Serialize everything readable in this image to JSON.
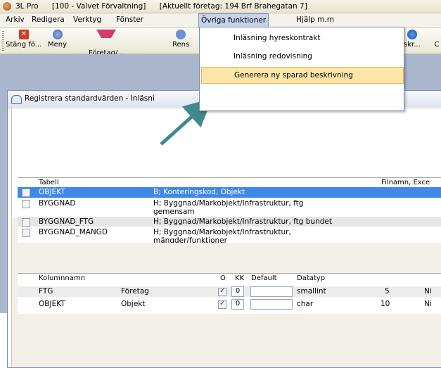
{
  "titlebar": {
    "app": "3L Pro",
    "db": "[100 - Valvet Förvaltning]",
    "company": "[Aktuellt företag: 194 Brf Brahegatan 7]"
  },
  "menubar": [
    "Arkiv",
    "Redigera",
    "Verktyg",
    "Fönster",
    "Övriga funktioner",
    "Hjälp m.m"
  ],
  "toolbar": [
    "Stäng fö...",
    "Meny",
    "Företag/...",
    "Rens",
    "skr...",
    "C"
  ],
  "dropdown": [
    "Inläsning hyreskontrakt",
    "Inläsning redovisning",
    "Generera ny sparad beskrivning"
  ],
  "window": {
    "title": "Registrera standardvärden - Inläsni"
  },
  "tables": {
    "headers": [
      "Tabell",
      "Filnamn, Exce"
    ],
    "rows": [
      {
        "name": "OBJEKT",
        "desc": "B; Konteringskod, Objekt"
      },
      {
        "name": "BYGGNAD",
        "desc": "H; Byggnad/Markobjekt/Infrastruktur, ftg",
        "desc2": "gemensam"
      },
      {
        "name": "BYGGNAD_FTG",
        "desc": "H; Byggnad/Markobjekt/Infrastruktur, ftg bundet"
      },
      {
        "name": "BYGGNAD_MANGD",
        "desc": "H; Byggnad/Markobjekt/Infrastruktur,",
        "desc2": "mängder/funktioner"
      }
    ]
  },
  "columns": {
    "headers": [
      "Kolumnnamn",
      "O",
      "KK",
      "Default",
      "Datatyp"
    ],
    "rows": [
      {
        "name": "FTG",
        "label": "Företag",
        "kk": "0",
        "type": "smallint",
        "len": "5",
        "tail": "Ni"
      },
      {
        "name": "OBJEKT",
        "label": "Objekt",
        "kk": "0",
        "type": "char",
        "len": "10",
        "tail": "Ni"
      }
    ]
  },
  "colors": {
    "selection": "#3e88e8",
    "highlight": "#fbe6a7",
    "arrow": "#3f8a8c"
  }
}
